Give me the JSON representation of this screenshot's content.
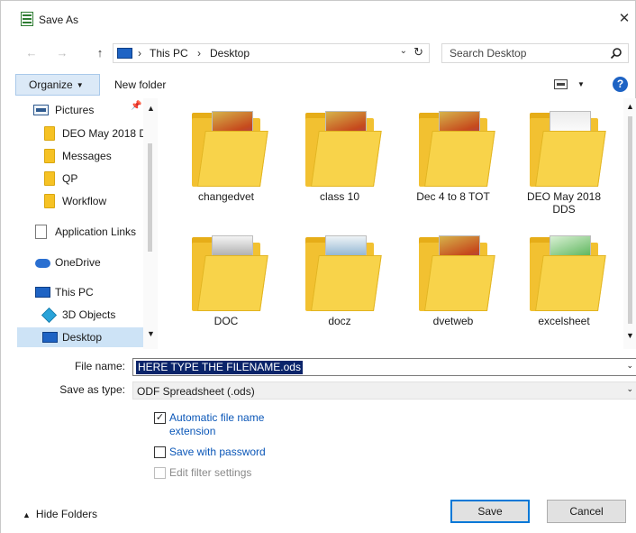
{
  "window": {
    "title": "Save As",
    "close_glyph": "✕"
  },
  "navigation": {
    "back_glyph": "←",
    "forward_glyph": "→",
    "up_glyph": "↑",
    "breadcrumb": [
      "This PC",
      "Desktop"
    ],
    "separator": "›",
    "search_placeholder": "Search Desktop"
  },
  "toolbar": {
    "organize_label": "Organize",
    "new_folder_label": "New folder",
    "help_label": "?"
  },
  "sidebar": {
    "items": [
      {
        "label": "Pictures",
        "icon": "pictures-icon"
      },
      {
        "label": "DEO May 2018 D",
        "icon": "folder-icon"
      },
      {
        "label": "Messages",
        "icon": "folder-icon"
      },
      {
        "label": "QP",
        "icon": "folder-icon"
      },
      {
        "label": "Workflow",
        "icon": "folder-icon"
      },
      {
        "label": "Application Links",
        "icon": "document-icon"
      },
      {
        "label": "OneDrive",
        "icon": "cloud-icon"
      },
      {
        "label": "This PC",
        "icon": "computer-icon"
      },
      {
        "label": "3D Objects",
        "icon": "cube-icon"
      },
      {
        "label": "Desktop",
        "icon": "desktop-icon",
        "selected": true
      }
    ]
  },
  "files": [
    {
      "label": "changedvet",
      "preview": "a"
    },
    {
      "label": "class 10",
      "preview": "a"
    },
    {
      "label": "Dec 4 to 8 TOT",
      "preview": "a"
    },
    {
      "label": "DEO May 2018 DDS",
      "preview": "b"
    },
    {
      "label": "DOC",
      "preview": "e"
    },
    {
      "label": "docz",
      "preview": "c"
    },
    {
      "label": "dvetweb",
      "preview": "a"
    },
    {
      "label": "excelsheet",
      "preview": "d"
    }
  ],
  "form": {
    "file_name_label": "File name:",
    "file_name_value": "HERE TYPE THE FILENAME.ods",
    "save_as_type_label": "Save as type:",
    "save_as_type_value": "ODF Spreadsheet (.ods)",
    "auto_extension_label": "Automatic file name extension",
    "auto_extension_checked": true,
    "save_with_password_label": "Save with password",
    "save_with_password_checked": false,
    "edit_filter_label": "Edit filter settings",
    "edit_filter_checked": false,
    "edit_filter_enabled": false
  },
  "footer": {
    "hide_folders_label": "Hide Folders",
    "save_label": "Save",
    "cancel_label": "Cancel"
  },
  "colors": {
    "accent": "#0078d7",
    "selection": "#0a246a",
    "organize_bg": "#dbe9f7",
    "folder": "#f2c131"
  }
}
